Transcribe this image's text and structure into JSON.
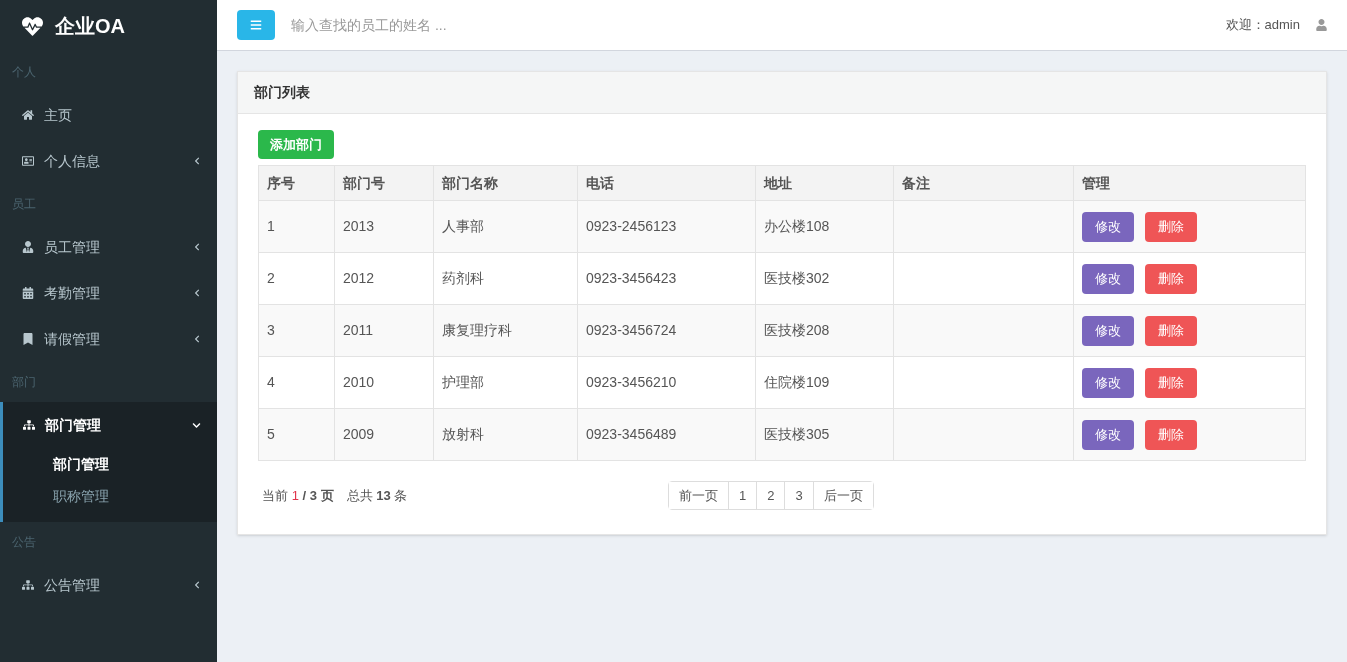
{
  "brand": {
    "title": "企业OA"
  },
  "sidebar": {
    "sections": [
      {
        "header": "个人",
        "items": [
          {
            "label": "主页",
            "kind": "home",
            "has_children": false,
            "expanded": false
          },
          {
            "label": "个人信息",
            "kind": "card",
            "has_children": true,
            "expanded": false
          }
        ]
      },
      {
        "header": "员工",
        "items": [
          {
            "label": "员工管理",
            "kind": "user",
            "has_children": true,
            "expanded": false
          },
          {
            "label": "考勤管理",
            "kind": "calendar",
            "has_children": true,
            "expanded": false
          },
          {
            "label": "请假管理",
            "kind": "bookmark",
            "has_children": true,
            "expanded": false
          }
        ]
      },
      {
        "header": "部门",
        "items": [
          {
            "label": "部门管理",
            "kind": "sitemap",
            "has_children": true,
            "expanded": true,
            "children": [
              {
                "label": "部门管理",
                "selected": true
              },
              {
                "label": "职称管理",
                "selected": false
              }
            ]
          }
        ]
      },
      {
        "header": "公告",
        "items": [
          {
            "label": "公告管理",
            "kind": "sitemap",
            "has_children": true,
            "expanded": false
          }
        ]
      }
    ]
  },
  "topbar": {
    "search": {
      "placeholder": "输入查找的员工的姓名 ..."
    },
    "welcome": "欢迎：admin"
  },
  "panel": {
    "title": "部门列表",
    "add_button": "添加部门",
    "table": {
      "columns": [
        "序号",
        "部门号",
        "部门名称",
        "电话",
        "地址",
        "备注",
        "管理"
      ],
      "rows": [
        {
          "cells": [
            "1",
            "2013",
            "人事部",
            "0923-2456123",
            "办公楼108",
            ""
          ],
          "actions": [
            "修改",
            "删除"
          ]
        },
        {
          "cells": [
            "2",
            "2012",
            "药剂科",
            "0923-3456423",
            "医技楼302",
            ""
          ],
          "actions": [
            "修改",
            "删除"
          ]
        },
        {
          "cells": [
            "3",
            "2011",
            "康复理疗科",
            "0923-3456724",
            "医技楼208",
            ""
          ],
          "actions": [
            "修改",
            "删除"
          ]
        },
        {
          "cells": [
            "4",
            "2010",
            "护理部",
            "0923-3456210",
            "住院楼109",
            ""
          ],
          "actions": [
            "修改",
            "删除"
          ]
        },
        {
          "cells": [
            "5",
            "2009",
            "放射科",
            "0923-3456489",
            "医技楼305",
            ""
          ],
          "actions": [
            "修改",
            "删除"
          ]
        }
      ]
    },
    "pager_info": {
      "prefix": "当前",
      "current": "1",
      "pages": "/ 3 页",
      "total_prefix": "总共",
      "total": "13",
      "total_suffix": "条"
    },
    "pagination": [
      {
        "label": "前一页",
        "selected": false
      },
      {
        "label": "1",
        "selected": false
      },
      {
        "label": "2",
        "selected": false
      },
      {
        "label": "3",
        "selected": false
      },
      {
        "label": "后一页",
        "selected": false
      }
    ]
  }
}
